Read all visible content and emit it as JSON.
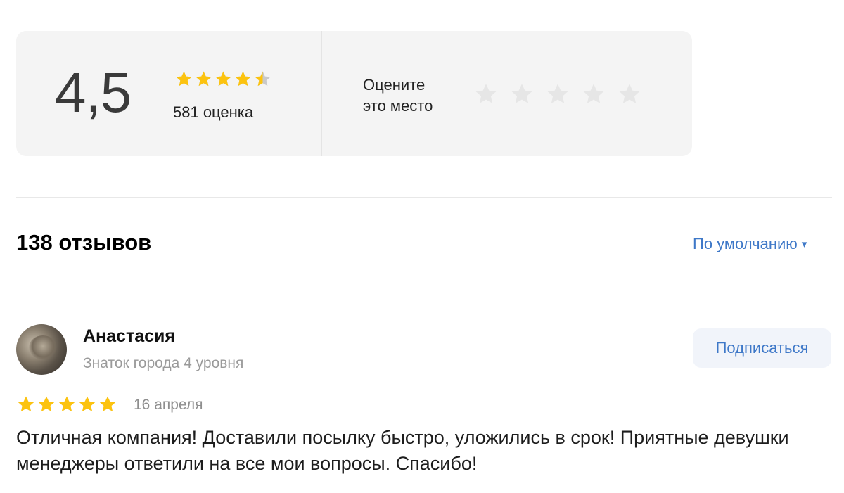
{
  "summary": {
    "score": "4,5",
    "average_rating": 4.5,
    "rating_count": "581 оценка",
    "rate_prompt_line1": "Оцените",
    "rate_prompt_line2": "это место",
    "rate_stars_count": 5
  },
  "reviews_header": {
    "count_label": "138 отзывов",
    "sort_label": "По умолчанию",
    "sort_arrow": "▾"
  },
  "review": {
    "author_name": "Анастасия",
    "author_level": "Знаток города 4 уровня",
    "subscribe_label": "Подписаться",
    "stars": 5,
    "date": "16 апреля",
    "text": "Отличная компания! Доставили посылку быстро, уложились в срок! Приятные девушки менеджеры ответили на все мои вопросы. Спасибо!"
  },
  "colors": {
    "star_filled": "#fcc30f",
    "star_empty": "#e6e6e6",
    "star_avg_empty": "#c9c9c9",
    "link_blue": "#3e78c8",
    "card_bg": "#f4f4f4"
  },
  "icons": {
    "star": "star-icon",
    "half_star": "half-star-icon",
    "chevron": "chevron-down-icon"
  }
}
